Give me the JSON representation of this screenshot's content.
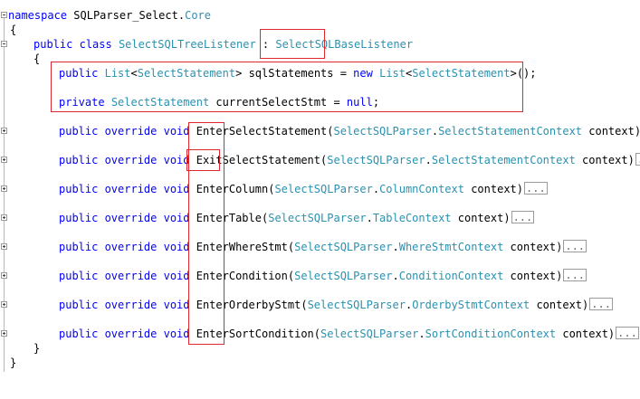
{
  "code": {
    "ns_keyword": "namespace",
    "ns_name": "SQLParser_Select.",
    "ns_core": "Core",
    "open_brace": "{",
    "close_brace": "}",
    "class_public": "public",
    "class_kw": "class",
    "class_name": "SelectSQLTreeListener",
    "colon": " : ",
    "base_class": "SelectSQLBaseListener",
    "field1_public": "public",
    "field1_type_list": "List",
    "field1_lt": "<",
    "field1_type_elem": "SelectStatement",
    "field1_gt": ">",
    "field1_name": " sqlStatements = ",
    "field1_new": "new",
    "field1_type_list2": "List",
    "field1_type_elem2": "SelectStatement",
    "field1_end": ">();",
    "field2_private": "private",
    "field2_type": "SelectStatement",
    "field2_name": " currentSelectStmt = ",
    "field2_null": "null",
    "field2_end": ";",
    "methods": [
      {
        "mods": "public override void",
        "name_prefix": "Enter",
        "name_rest": "SelectStatement",
        "param_ns": "SelectSQLParser",
        "param_type": "SelectStatementContext",
        "param_name": " context)",
        "collapsed": "..."
      },
      {
        "mods": "public override void",
        "name_prefix": "Exit",
        "name_rest": "SelectStatement",
        "param_ns": "SelectSQLParser",
        "param_type": "SelectStatementContext",
        "param_name": " context)",
        "collapsed": "..."
      },
      {
        "mods": "public override void",
        "name_prefix": "Enter",
        "name_rest": "Column",
        "param_ns": "SelectSQLParser",
        "param_type": "ColumnContext",
        "param_name": " context)",
        "collapsed": "..."
      },
      {
        "mods": "public override void",
        "name_prefix": "Enter",
        "name_rest": "Table",
        "param_ns": "SelectSQLParser",
        "param_type": "TableContext",
        "param_name": " context)",
        "collapsed": "..."
      },
      {
        "mods": "public override void",
        "name_prefix": "Enter",
        "name_rest": "WhereStmt",
        "param_ns": "SelectSQLParser",
        "param_type": "WhereStmtContext",
        "param_name": " context)",
        "collapsed": "..."
      },
      {
        "mods": "public override void",
        "name_prefix": "Enter",
        "name_rest": "Condition",
        "param_ns": "SelectSQLParser",
        "param_type": "ConditionContext",
        "param_name": " context)",
        "collapsed": "..."
      },
      {
        "mods": "public override void",
        "name_prefix": "Enter",
        "name_rest": "OrderbyStmt",
        "param_ns": "SelectSQLParser",
        "param_type": "OrderbyStmtContext",
        "param_name": " context)",
        "collapsed": "..."
      },
      {
        "mods": "public override void",
        "name_prefix": "Enter",
        "name_rest": "SortCondition",
        "param_ns": "SelectSQLParser",
        "param_type": "SortConditionContext",
        "param_name": " context)",
        "collapsed": "..."
      }
    ],
    "dot": ".",
    "paren": "(",
    "highlight_color": "#e0262e",
    "keyword_color": "#0000ff",
    "type_color": "#2b91af"
  }
}
